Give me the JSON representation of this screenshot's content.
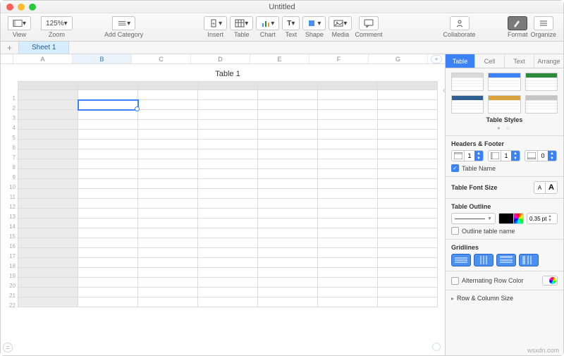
{
  "window": {
    "title": "Untitled"
  },
  "toolbar": {
    "view": "View",
    "zoom": "Zoom",
    "zoom_value": "125%",
    "add_category": "Add Category",
    "insert": "Insert",
    "table": "Table",
    "chart": "Chart",
    "text": "Text",
    "shape": "Shape",
    "media": "Media",
    "comment": "Comment",
    "collaborate": "Collaborate",
    "format": "Format",
    "organize": "Organize"
  },
  "sheets": {
    "add": "+",
    "tab1": "Sheet 1"
  },
  "columns": [
    "A",
    "B",
    "C",
    "D",
    "E",
    "F",
    "G"
  ],
  "rows": [
    "1",
    "2",
    "3",
    "4",
    "5",
    "6",
    "7",
    "8",
    "9",
    "10",
    "11",
    "12",
    "13",
    "14",
    "15",
    "16",
    "17",
    "18",
    "19",
    "20",
    "21",
    "22"
  ],
  "selected_column": "B",
  "selected_cell_row": "2",
  "table_title": "Table 1",
  "inspector": {
    "tabs": {
      "table": "Table",
      "cell": "Cell",
      "text": "Text",
      "arrange": "Arrange"
    },
    "styles_caption": "Table Styles",
    "style_colors": [
      "#d9d9d9",
      "#3b82f6",
      "#2e8b3d",
      "#2f5f8f",
      "#d9a23d",
      "#c4c4c4"
    ],
    "headers_footer": "Headers & Footer",
    "hf": {
      "header_rows": "1",
      "header_cols": "1",
      "footer_rows": "0"
    },
    "table_name_label": "Table Name",
    "font_size_label": "Table Font Size",
    "font_small": "A",
    "font_big": "A",
    "outline_label": "Table Outline",
    "outline_pt": "0.35 pt",
    "outline_name_label": "Outline table name",
    "gridlines_label": "Gridlines",
    "alt_row_label": "Alternating Row Color",
    "row_col_size": "Row & Column Size"
  },
  "watermark": "wsxdn.com"
}
